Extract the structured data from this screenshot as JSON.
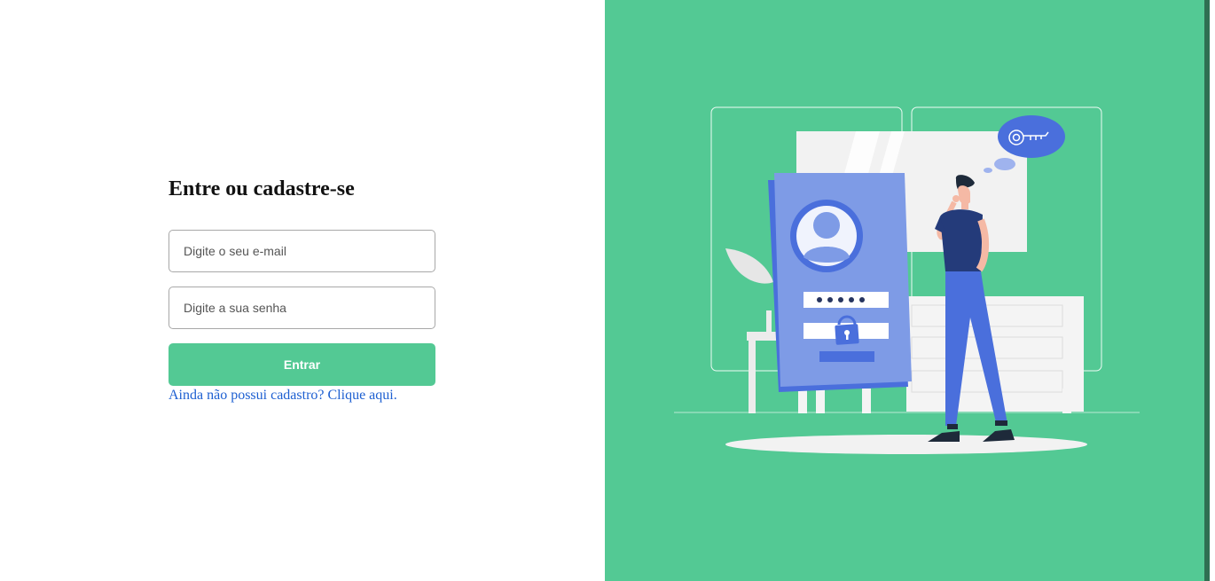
{
  "login": {
    "title": "Entre ou cadastre-se",
    "email_placeholder": "Digite o seu e-mail",
    "password_placeholder": "Digite a sua senha",
    "submit_label": "Entrar",
    "signup_link": "Ainda não possui cadastro? Clique aqui."
  },
  "colors": {
    "accent": "#53c994",
    "link": "#1d5fd1",
    "card": "#7e9be6",
    "card_dark": "#4a6fdc",
    "shirt": "#243b7a"
  },
  "illustration": {
    "icon": "login-illustration",
    "bubble_icon": "key-icon",
    "lock_icon": "lock-icon",
    "avatar_icon": "user-avatar-icon"
  }
}
